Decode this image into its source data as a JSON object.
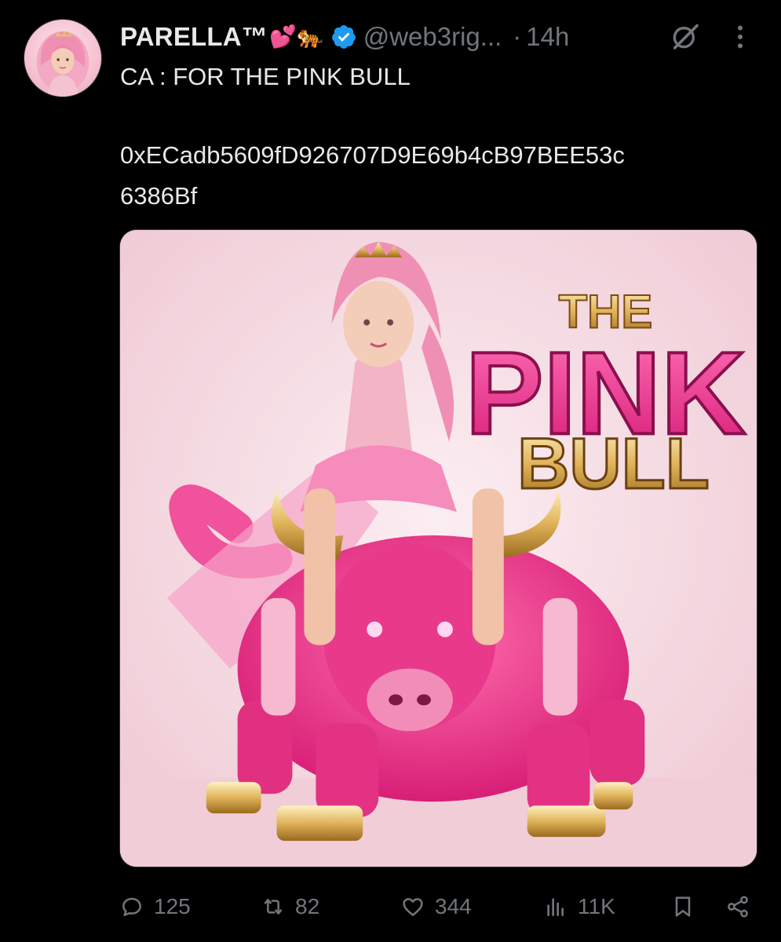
{
  "author": {
    "display_name": "PARELLA™",
    "name_emojis": "💕🐅",
    "handle": "@web3rig...",
    "separator": "·",
    "timestamp": "14h"
  },
  "tweet": {
    "line1": "CA : FOR THE PINK BULL",
    "address_line1": "0xECadb5609fD926707D9E69b4cB97BEE53c",
    "address_line2": "6386Bf"
  },
  "media": {
    "logo_top": "THE",
    "logo_mid": "PINK",
    "logo_bottom": "BULL"
  },
  "actions": {
    "replies": "125",
    "reposts": "82",
    "likes": "344",
    "views": "11K"
  },
  "colors": {
    "background": "#000000",
    "text_primary": "#e7e9ea",
    "text_secondary": "#71767b",
    "verified_blue": "#1d9bf0",
    "pink": "#ff2f8f",
    "gold": "#d9a441"
  }
}
